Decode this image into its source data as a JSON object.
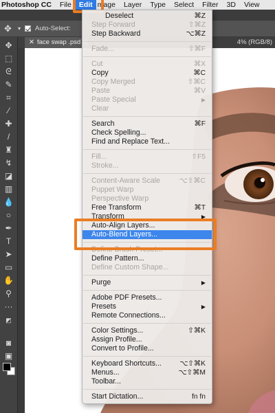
{
  "menubar": {
    "app": "Photoshop CC",
    "items": [
      "File",
      "Edit",
      "Image",
      "Layer",
      "Type",
      "Select",
      "Filter",
      "3D",
      "View"
    ],
    "visible": [
      "File",
      "Edit",
      "mage",
      "Layer",
      "Type",
      "Select",
      "Filter",
      "3D",
      "View"
    ]
  },
  "options_bar": {
    "auto_select_label": "Auto-Select:",
    "zoom_suffix": "4% (RGB/8)"
  },
  "document_tab": {
    "title": "face swap .psd @ 2"
  },
  "edit_menu": {
    "items": [
      {
        "label": "Deselect",
        "shortcut": "⌘Z",
        "enabled": true,
        "visible_label": "Deselect"
      },
      {
        "label": "Step Forward",
        "shortcut": "⇧⌘Z",
        "enabled": false
      },
      {
        "label": "Step Backward",
        "shortcut": "⌥⌘Z",
        "enabled": true
      },
      {
        "label": "Fade...",
        "shortcut": "⇧⌘F",
        "enabled": false
      },
      {
        "label": "Cut",
        "shortcut": "⌘X",
        "enabled": false
      },
      {
        "label": "Copy",
        "shortcut": "⌘C",
        "enabled": true
      },
      {
        "label": "Copy Merged",
        "shortcut": "⇧⌘C",
        "enabled": false
      },
      {
        "label": "Paste",
        "shortcut": "⌘V",
        "enabled": false
      },
      {
        "label": "Paste Special",
        "shortcut": "",
        "enabled": false,
        "submenu": true
      },
      {
        "label": "Clear",
        "shortcut": "",
        "enabled": false
      },
      {
        "label": "Search",
        "shortcut": "⌘F",
        "enabled": true
      },
      {
        "label": "Check Spelling...",
        "shortcut": "",
        "enabled": true
      },
      {
        "label": "Find and Replace Text...",
        "shortcut": "",
        "enabled": true
      },
      {
        "label": "Fill...",
        "shortcut": "⇧F5",
        "enabled": false
      },
      {
        "label": "Stroke...",
        "shortcut": "",
        "enabled": false
      },
      {
        "label": "Content-Aware Scale",
        "shortcut": "⌥⇧⌘C",
        "enabled": false
      },
      {
        "label": "Puppet Warp",
        "shortcut": "",
        "enabled": false
      },
      {
        "label": "Perspective Warp",
        "shortcut": "",
        "enabled": false
      },
      {
        "label": "Free Transform",
        "shortcut": "⌘T",
        "enabled": true
      },
      {
        "label": "Transform",
        "shortcut": "",
        "enabled": true,
        "submenu": true
      },
      {
        "label": "Auto-Align Layers...",
        "shortcut": "",
        "enabled": true
      },
      {
        "label": "Auto-Blend Layers...",
        "shortcut": "",
        "enabled": true,
        "highlighted": true
      },
      {
        "label": "Define Brush Preset...",
        "shortcut": "",
        "enabled": false
      },
      {
        "label": "Define Pattern...",
        "shortcut": "",
        "enabled": true
      },
      {
        "label": "Define Custom Shape...",
        "shortcut": "",
        "enabled": false
      },
      {
        "label": "Purge",
        "shortcut": "",
        "enabled": true,
        "submenu": true
      },
      {
        "label": "Adobe PDF Presets...",
        "shortcut": "",
        "enabled": true
      },
      {
        "label": "Presets",
        "shortcut": "",
        "enabled": true,
        "submenu": true
      },
      {
        "label": "Remote Connections...",
        "shortcut": "",
        "enabled": true
      },
      {
        "label": "Color Settings...",
        "shortcut": "⇧⌘K",
        "enabled": true
      },
      {
        "label": "Assign Profile...",
        "shortcut": "",
        "enabled": true
      },
      {
        "label": "Convert to Profile...",
        "shortcut": "",
        "enabled": true
      },
      {
        "label": "Keyboard Shortcuts...",
        "shortcut": "⌥⇧⌘K",
        "enabled": true
      },
      {
        "label": "Menus...",
        "shortcut": "⌥⇧⌘M",
        "enabled": true
      },
      {
        "label": "Toolbar...",
        "shortcut": "",
        "enabled": true
      },
      {
        "label": "Start Dictation...",
        "shortcut": "fn fn",
        "enabled": true
      }
    ]
  },
  "colors": {
    "highlight": "#3d86ec",
    "annotation": "#ea7d24",
    "menubar_active": "#2f7be4"
  }
}
